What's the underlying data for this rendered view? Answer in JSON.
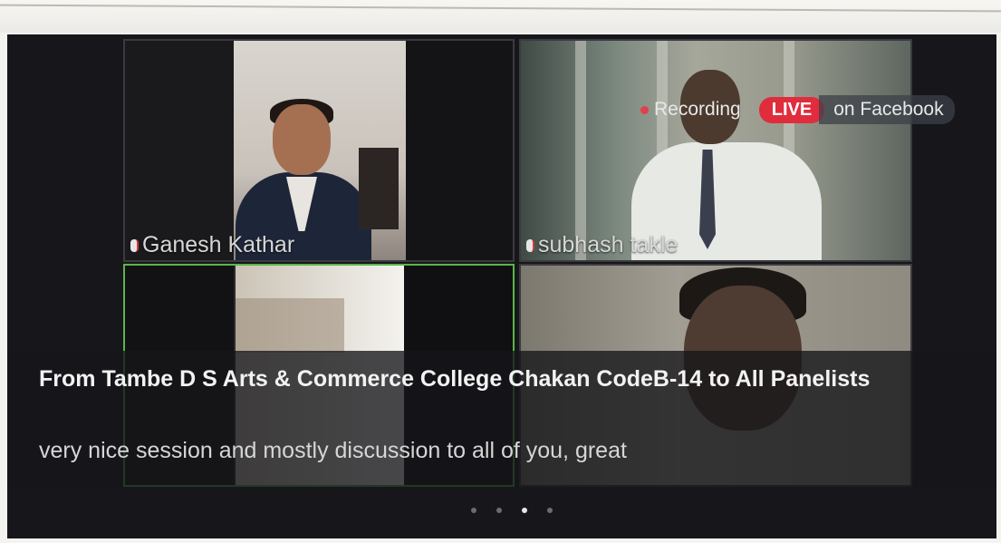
{
  "participants": [
    {
      "name": "Ganesh Kathar"
    },
    {
      "name": "subhash takle"
    },
    {
      "name": ""
    },
    {
      "name": ""
    }
  ],
  "status": {
    "recording": "Recording",
    "live": "LIVE",
    "on": "on Facebook"
  },
  "chat": {
    "from": "From Tambe D S Arts & Commerce College Chakan CodeB-14 to All Panelists",
    "message": "very nice session and mostly discussion to all of you, great"
  },
  "pagination": {
    "total": 4,
    "active_index": 3
  }
}
